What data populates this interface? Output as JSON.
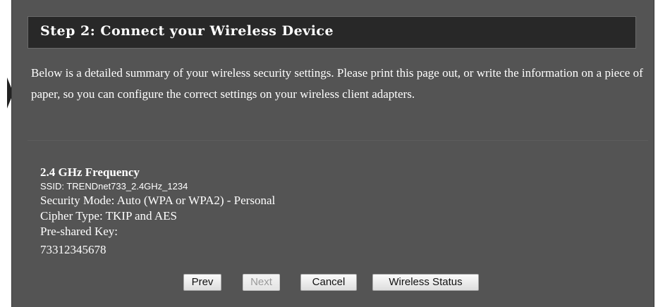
{
  "header": {
    "title": "Step 2: Connect your Wireless Device"
  },
  "intro": {
    "text": "Below is a detailed summary of your wireless security settings. Please print this page out, or write the information on a piece of paper, so you can configure the correct settings on your wireless client adapters."
  },
  "summary": {
    "frequency_heading": "2.4 GHz Frequency",
    "ssid": "SSID: TRENDnet733_2.4GHz_1234",
    "security_mode": "Security Mode: Auto (WPA or WPA2) - Personal",
    "cipher_type": "Cipher Type: TKIP and AES",
    "psk_label": "Pre-shared Key:",
    "psk_value": "73312345678"
  },
  "buttons": {
    "prev": "Prev",
    "next": "Next",
    "cancel": "Cancel",
    "wireless_status": "Wireless Status"
  }
}
